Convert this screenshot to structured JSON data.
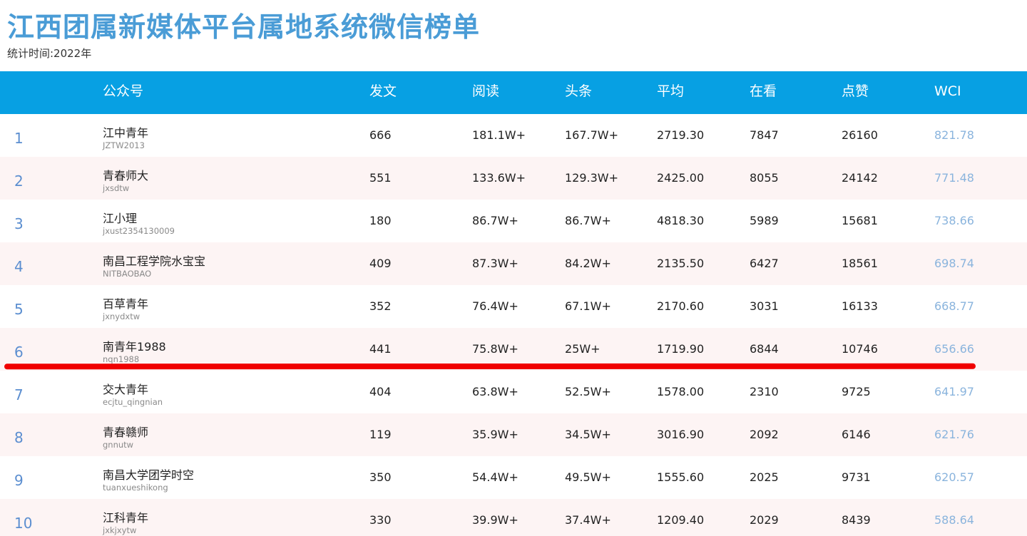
{
  "page": {
    "title": "江西团属新媒体平台属地系统微信榜单",
    "subtitle": "统计时间:2022年"
  },
  "table": {
    "headers": {
      "account": "公众号",
      "posts": "发文",
      "reads": "阅读",
      "headline": "头条",
      "average": "平均",
      "watching": "在看",
      "likes": "点赞",
      "wci": "WCI"
    },
    "rows": [
      {
        "rank": "1",
        "name": "江中青年",
        "id": "JZTW2013",
        "posts": "666",
        "reads": "181.1W+",
        "headline": "167.7W+",
        "average": "2719.30",
        "watching": "7847",
        "likes": "26160",
        "wci": "821.78"
      },
      {
        "rank": "2",
        "name": "青春师大",
        "id": "jxsdtw",
        "posts": "551",
        "reads": "133.6W+",
        "headline": "129.3W+",
        "average": "2425.00",
        "watching": "8055",
        "likes": "24142",
        "wci": "771.48"
      },
      {
        "rank": "3",
        "name": "江小理",
        "id": "jxust2354130009",
        "posts": "180",
        "reads": "86.7W+",
        "headline": "86.7W+",
        "average": "4818.30",
        "watching": "5989",
        "likes": "15681",
        "wci": "738.66"
      },
      {
        "rank": "4",
        "name": "南昌工程学院水宝宝",
        "id": "NITBAOBAO",
        "posts": "409",
        "reads": "87.3W+",
        "headline": "84.2W+",
        "average": "2135.50",
        "watching": "6427",
        "likes": "18561",
        "wci": "698.74"
      },
      {
        "rank": "5",
        "name": "百草青年",
        "id": "jxnydxtw",
        "posts": "352",
        "reads": "76.4W+",
        "headline": "67.1W+",
        "average": "2170.60",
        "watching": "3031",
        "likes": "16133",
        "wci": "668.77"
      },
      {
        "rank": "6",
        "name": "南青年1988",
        "id": "nqn1988",
        "posts": "441",
        "reads": "75.8W+",
        "headline": "25W+",
        "average": "1719.90",
        "watching": "6844",
        "likes": "10746",
        "wci": "656.66"
      },
      {
        "rank": "7",
        "name": "交大青年",
        "id": "ecjtu_qingnian",
        "posts": "404",
        "reads": "63.8W+",
        "headline": "52.5W+",
        "average": "1578.00",
        "watching": "2310",
        "likes": "9725",
        "wci": "641.97"
      },
      {
        "rank": "8",
        "name": "青春赣师",
        "id": "gnnutw",
        "posts": "119",
        "reads": "35.9W+",
        "headline": "34.5W+",
        "average": "3016.90",
        "watching": "2092",
        "likes": "6146",
        "wci": "621.76"
      },
      {
        "rank": "9",
        "name": "南昌大学团学时空",
        "id": "tuanxueshikong",
        "posts": "350",
        "reads": "54.4W+",
        "headline": "49.5W+",
        "average": "1555.60",
        "watching": "2025",
        "likes": "9731",
        "wci": "620.57"
      },
      {
        "rank": "10",
        "name": "江科青年",
        "id": "jxkjxytw",
        "posts": "330",
        "reads": "39.9W+",
        "headline": "37.4W+",
        "average": "1209.40",
        "watching": "2029",
        "likes": "8439",
        "wci": "588.64"
      }
    ]
  },
  "colors": {
    "title": "#4a9cd6",
    "header_bg": "#07a0e3",
    "rank": "#5b8ed0",
    "wci": "#8ab4dd",
    "alt_row_bg": "#fdf4f4",
    "highlight_line": "#f00000"
  }
}
